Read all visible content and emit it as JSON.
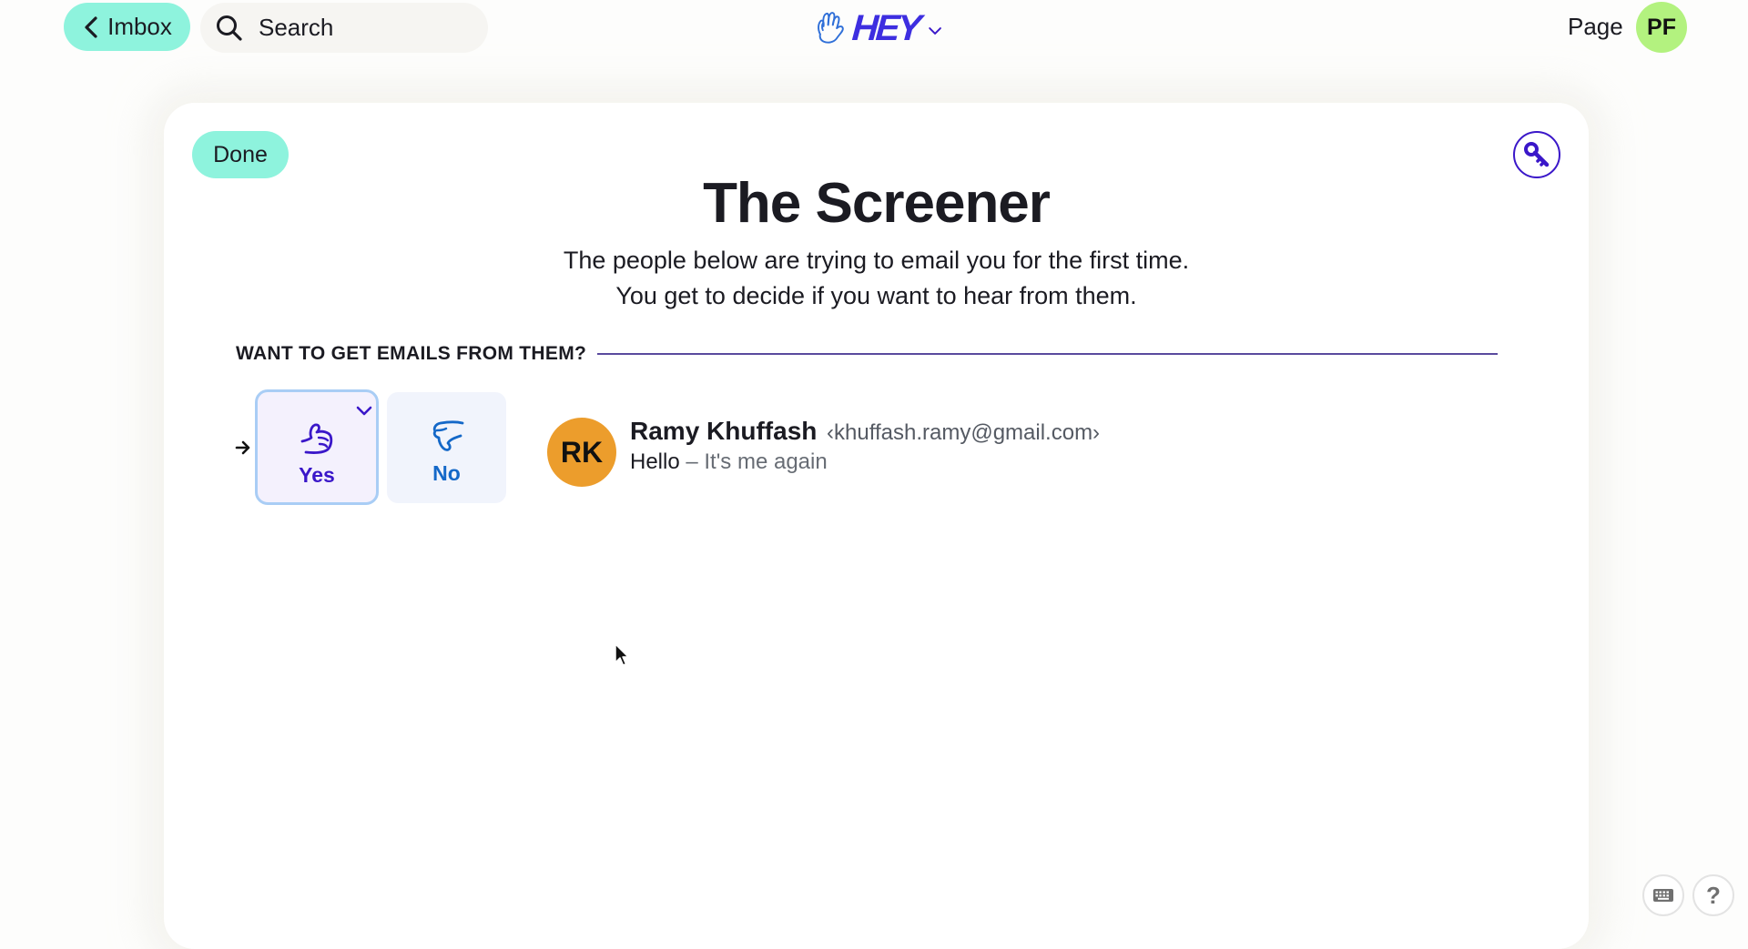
{
  "topbar": {
    "back_button": {
      "label": "Imbox",
      "icon": "chevron-left-icon"
    },
    "search": {
      "placeholder": "Search",
      "value": "",
      "icon": "search-icon"
    },
    "logo": {
      "wordmark": "HEY",
      "icon": "hey-hand-logo",
      "menu_icon": "chevron-down-icon"
    },
    "page_link": "Page",
    "user_avatar": {
      "initials": "PF",
      "color": "#b3f27f"
    }
  },
  "screener": {
    "done_label": "Done",
    "key_icon": "key-icon",
    "title": "The Screener",
    "subtitle_line1": "The people below are trying to email you for the first time.",
    "subtitle_line2": "You get to decide if you want to hear from them.",
    "section_label": "WANT TO GET EMAILS FROM THEM?",
    "entries": [
      {
        "selected": true,
        "yes_label": "Yes",
        "no_label": "No",
        "avatar_initials": "RK",
        "avatar_color": "#ec9d2c",
        "sender_name": "Ramy Khuffash",
        "sender_email": "‹khuffash.ramy@gmail.com›",
        "subject": "Hello",
        "separator": " – ",
        "snippet": "It's me again"
      }
    ]
  },
  "colors": {
    "accent_mint": "#8ef3dd",
    "brand_purple": "#3a17c9",
    "no_blue": "#1468c8"
  },
  "utility": {
    "keyboard_shortcuts_icon": "keyboard-icon",
    "help_label": "?"
  }
}
